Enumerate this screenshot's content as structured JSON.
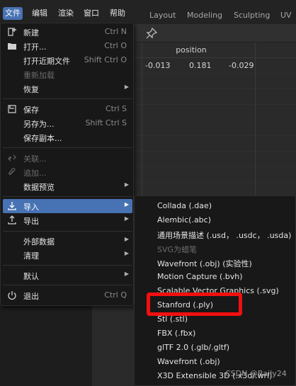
{
  "topbar": {
    "menus": [
      "文件",
      "编辑",
      "渲染",
      "窗口",
      "帮助"
    ],
    "workspaces": [
      "Layout",
      "Modeling",
      "Sculpting",
      "UV E"
    ]
  },
  "spreadsheet": {
    "column_header": "position",
    "row": [
      "-0.013",
      "0.181",
      "-0.029"
    ]
  },
  "file_menu": {
    "new": {
      "label": "新建",
      "shortcut": "Ctrl N"
    },
    "open": {
      "label": "打开...",
      "shortcut": "Ctrl O"
    },
    "open_recent": {
      "label": "打开近期文件",
      "shortcut": "Shift Ctrl O"
    },
    "revert": {
      "label": "重新加载"
    },
    "recover": {
      "label": "恢复"
    },
    "save": {
      "label": "保存",
      "shortcut": "Ctrl S"
    },
    "save_as": {
      "label": "另存为...",
      "shortcut": "Shift Ctrl S"
    },
    "save_copy": {
      "label": "保存副本..."
    },
    "link": {
      "label": "关联..."
    },
    "append": {
      "label": "追加..."
    },
    "data_preview": {
      "label": "数据预览"
    },
    "import": {
      "label": "导入"
    },
    "export": {
      "label": "导出"
    },
    "external_data": {
      "label": "外部数据"
    },
    "clean_up": {
      "label": "清理"
    },
    "defaults": {
      "label": "默认"
    },
    "quit": {
      "label": "退出",
      "shortcut": "Ctrl Q"
    }
  },
  "import_menu": {
    "items": [
      "Collada (.dae)",
      "Alembic(.abc)",
      "通用场景描述 (.usd， .usdc， .usda)",
      "SVG为蜡笔",
      "Wavefront (.obj) (实验性)",
      "Motion Capture (.bvh)",
      "Scalable Vector Graphics (.svg)",
      "Stanford (.ply)",
      "Stl (.stl)",
      "FBX (.fbx)",
      "glTF 2.0 (.glb/.gltf)",
      "Wavefront (.obj)",
      "X3D Extensible 3D (.x3d/.wrl)"
    ]
  },
  "watermark": "CSDN @Baily24",
  "colors": {
    "accent": "#4772b3",
    "highlight_box": "#f20f0f",
    "menu_bg": "#181818"
  }
}
